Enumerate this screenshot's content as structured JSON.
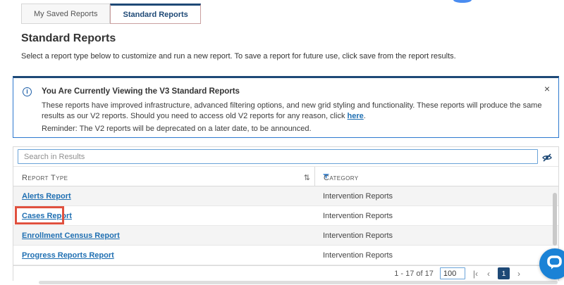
{
  "tabs": [
    {
      "label": "My Saved Reports",
      "active": false
    },
    {
      "label": "Standard Reports",
      "active": true
    }
  ],
  "page": {
    "title": "Standard Reports",
    "subtitle": "Select a report type below to customize and run a new report. To save a report for future use, click save from the report results."
  },
  "banner": {
    "info_glyph": "i",
    "title": "You Are Currently Viewing the V3 Standard Reports",
    "body_before_link": "These reports have improved infrastructure, advanced filtering options, and new grid styling and functionality. These reports will produce the same results as our V2 reports. Should you need to access old V2 reports for any reason, click ",
    "link_text": "here",
    "body_after_link": ".",
    "reminder": "Reminder: The V2 reports will be deprecated on a later date, to be announced.",
    "close_glyph": "×"
  },
  "search": {
    "placeholder": "Search in Results"
  },
  "table": {
    "columns": [
      {
        "label": "Report Type",
        "sort_icon": "⇅"
      },
      {
        "label": "Category"
      }
    ],
    "rows": [
      {
        "report_type": "Alerts Report",
        "category": "Intervention Reports"
      },
      {
        "report_type": "Cases Report",
        "category": "Intervention Reports"
      },
      {
        "report_type": "Enrollment Census Report",
        "category": "Intervention Reports"
      },
      {
        "report_type": "Progress Reports Report",
        "category": "Intervention Reports"
      }
    ]
  },
  "pagination": {
    "range_text": "1 - 17 of 17",
    "page_size": "100",
    "first_glyph": "|‹",
    "prev_glyph": "‹",
    "current_page": "1",
    "next_glyph": "›"
  },
  "colors": {
    "navy": "#1e4976",
    "link_blue": "#1f6fb2",
    "banner_border_blue": "#2e79cf",
    "search_border_blue": "#6aa3d8",
    "stripe_gray": "#f4f4f4",
    "highlight_red": "#e0513f",
    "chat_blue": "#1a82d6"
  }
}
